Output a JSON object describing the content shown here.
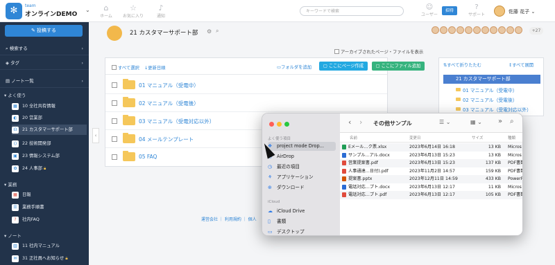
{
  "topbar": {
    "brand_small": "team",
    "brand": "オンラインDEMO",
    "nav": [
      {
        "label": "ホーム",
        "icon": "home-icon"
      },
      {
        "label": "お気に入り",
        "icon": "star-icon"
      },
      {
        "label": "通知",
        "icon": "bell-icon"
      }
    ],
    "search_placeholder": "キーワードで検索",
    "users_label": "ユーザー",
    "invite_label": "招待",
    "support_label": "サポート",
    "user_name": "佐藤 花子"
  },
  "sidebar": {
    "post_label": "投稿する",
    "rows": [
      {
        "label": "検索する",
        "icon": "search-icon"
      },
      {
        "label": "タグ",
        "icon": "tag-icon"
      },
      {
        "label": "ノート一覧",
        "icon": "notebook-icon"
      }
    ],
    "sections": [
      {
        "label": "よく使う",
        "items": [
          "10 全社共有情報",
          "20 営業部",
          "21 カスタマーサポート部",
          "22 技術開発部",
          "23 情報システム部",
          "24 人事部"
        ]
      },
      {
        "label": "業務",
        "items": [
          "日報",
          "業務手順書",
          "社内FAQ"
        ]
      },
      {
        "label": "ノート",
        "items": [
          "11 社内マニュアル",
          "31 正社員へお知らせ"
        ]
      }
    ]
  },
  "page": {
    "title": "21 カスタマーサポート部",
    "more_members": "+27",
    "archive_label": "アーカイブされたページ・ファイルを表示"
  },
  "list": {
    "select_all": "すべて選択",
    "sort": "更新日順",
    "add_folder": "フォルダを追加",
    "create_page": "ここにページ作成",
    "add_file": "ここにファイル追加",
    "folders": [
      "01 マニュアル（受電中）",
      "02 マニュアル（受電後）",
      "03 マニュアル（受電対応以外）",
      "04 メールテンプレート",
      "05 FAQ"
    ]
  },
  "tree": {
    "collapse_all": "すべて折りたたむ",
    "expand_all": "すべて展開",
    "root": "21 カスタマーサポート部",
    "items": [
      "01 マニュアル（受電中）",
      "02 マニュアル（受電後）",
      "03 マニュアル（受電対応以外）"
    ]
  },
  "footer": {
    "text": "運営会社 ｜ 利用規約 ｜ 個人"
  },
  "finder": {
    "title": "その他サンプル",
    "favorites_label": "よく使う項目",
    "icloud_label": "iCloud",
    "sidebar_items": [
      "project mode Drop...",
      "AirDrop",
      "最近の項目",
      "アプリケーション",
      "ダウンロード"
    ],
    "icloud_items": [
      "iCloud Drive",
      "書類",
      "デスクトップ"
    ],
    "columns": {
      "name": "名前",
      "modified": "変更日",
      "size": "サイズ",
      "kind": "種類"
    },
    "files": [
      {
        "name": "Eメール…ク票.xlsx",
        "date": "2023年6月14日 16:18",
        "size": "13 KB",
        "kind": "Micros",
        "color": "#1f9d55"
      },
      {
        "name": "サンプル…アル.docx",
        "date": "2023年6月13日 15:23",
        "size": "13 KB",
        "kind": "Micros",
        "color": "#2b6cd4"
      },
      {
        "name": "営業提案書.pdf",
        "date": "2023年6月13日 15:23",
        "size": "137 KB",
        "kind": "PDF書類",
        "color": "#e04b3c"
      },
      {
        "name": "人事通達…日付).pdf",
        "date": "2023年11月2日 14:57",
        "size": "159 KB",
        "kind": "PDF書類",
        "color": "#e04b3c"
      },
      {
        "name": "提案書.pptx",
        "date": "2023年12月11日 14:59",
        "size": "433 KB",
        "kind": "PowerP",
        "color": "#d35400"
      },
      {
        "name": "電話対応…プト.docx",
        "date": "2023年6月13日 12:17",
        "size": "11 KB",
        "kind": "Micros",
        "color": "#2b6cd4"
      },
      {
        "name": "電話対応…プト.pdf",
        "date": "2023年6月13日 12:17",
        "size": "105 KB",
        "kind": "PDF書類",
        "color": "#e04b3c"
      }
    ]
  }
}
